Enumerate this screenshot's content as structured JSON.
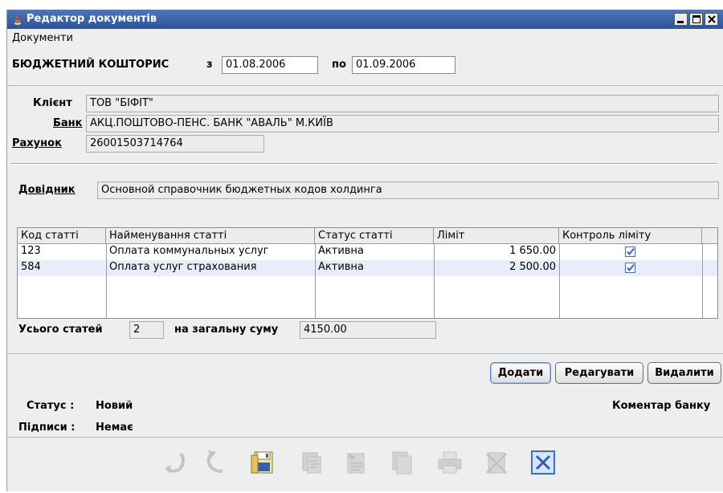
{
  "window": {
    "title": "Редактор документів"
  },
  "menu": {
    "documents": "Документи"
  },
  "header": {
    "doc_type": "БЮДЖЕТНИЙ КОШТОРИС",
    "from_label": "з",
    "from_date": "01.08.2006",
    "to_label": "по",
    "to_date": "01.09.2006"
  },
  "client": {
    "client_label": "Клієнт",
    "client_value": "ТОВ \"БІФІТ\"",
    "bank_label": "Банк",
    "bank_value": "АКЦ.ПОШТОВО-ПЕНС. БАНК \"АВАЛЬ\" М.КИЇВ",
    "account_label": "Рахунок",
    "account_value": "26001503714764"
  },
  "directory": {
    "label": "Довідник",
    "value": "Основной справочник бюджетных кодов холдинга"
  },
  "table": {
    "columns": [
      "Код статті",
      "Найменування статті",
      "Статус статті",
      "Ліміт",
      "Контроль ліміту"
    ],
    "rows": [
      {
        "code": "123",
        "name": "Оплата коммунальных услуг",
        "status": "Активна",
        "limit": "1 650.00",
        "control": true
      },
      {
        "code": "584",
        "name": "Оплата услуг страхования",
        "status": "Активна",
        "limit": "2 500.00",
        "control": true
      }
    ]
  },
  "totals": {
    "count_label": "Усього статей",
    "count_value": "2",
    "sum_label": "на загальну суму",
    "sum_value": "4150.00"
  },
  "actions": {
    "add": "Додати",
    "edit": "Редагувати",
    "delete": "Видалити"
  },
  "status": {
    "status_label": "Статус :",
    "status_value": "Новий",
    "signatures_label": "Підписи :",
    "signatures_value": "Немає",
    "bank_comment": "Коментар банку"
  },
  "toolbar_icons": [
    "undo-icon",
    "redo-icon",
    "save-icon",
    "copy-icon",
    "sign-icon",
    "duplicate-icon",
    "print-icon",
    "delete-doc-icon",
    "close-icon"
  ],
  "colors": {
    "titlebar": "#2c529a",
    "window_bg": "#eeeeee",
    "row_highlight": "#e8edf7",
    "check_blue": "#3a6fc4"
  }
}
